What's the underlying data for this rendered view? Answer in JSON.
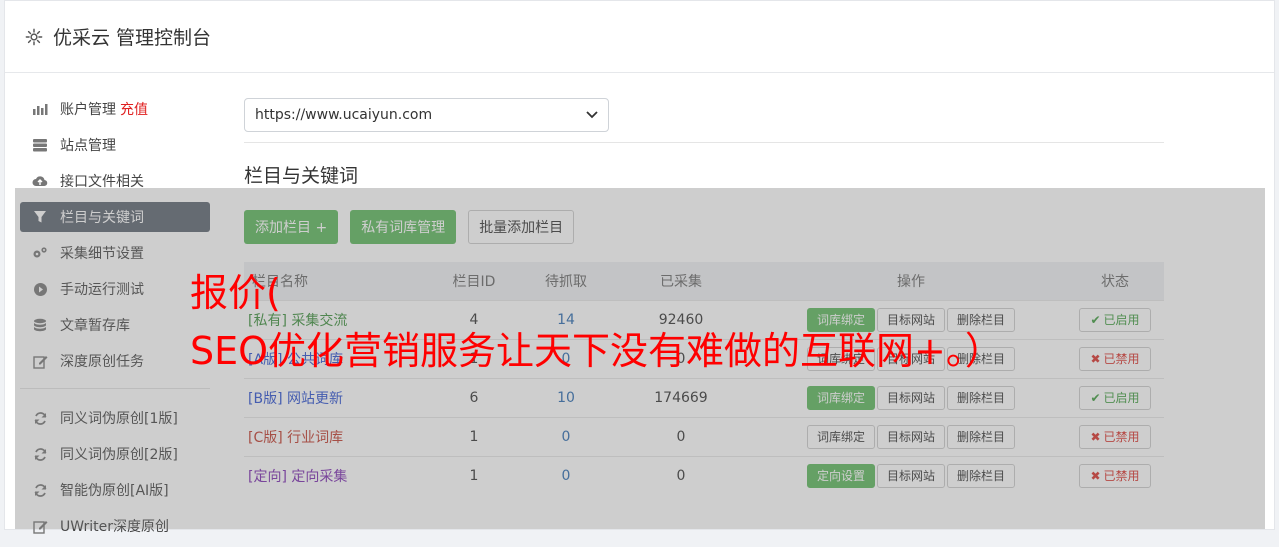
{
  "header": {
    "title": "优采云 管理控制台"
  },
  "sidebar": {
    "items": [
      {
        "label": "账户管理",
        "extra": "充值",
        "icon": "bar-chart-icon"
      },
      {
        "label": "站点管理",
        "icon": "server-icon"
      },
      {
        "label": "接口文件相关",
        "icon": "cloud-upload-icon"
      },
      {
        "label": "栏目与关键词",
        "icon": "filter-icon",
        "active": true
      },
      {
        "label": "采集细节设置",
        "icon": "cogs-icon"
      },
      {
        "label": "手动运行测试",
        "icon": "play-circle-icon"
      },
      {
        "label": "文章暂存库",
        "icon": "database-icon"
      },
      {
        "label": "深度原创任务",
        "icon": "edit-icon"
      }
    ],
    "items2": [
      {
        "label": "同义词伪原创[1版]",
        "icon": "refresh-icon"
      },
      {
        "label": "同义词伪原创[2版]",
        "icon": "refresh-icon"
      },
      {
        "label": "智能伪原创[AI版]",
        "icon": "refresh-icon"
      },
      {
        "label": "UWriter深度原创",
        "icon": "edit-icon"
      }
    ]
  },
  "main": {
    "site_select": "https://www.ucaiyun.com",
    "section_title": "栏目与关键词",
    "buttons": {
      "add": "添加栏目 +",
      "private_lib": "私有词库管理",
      "batch_add": "批量添加栏目"
    },
    "table": {
      "headers": [
        "栏目名称",
        "栏目ID",
        "待抓取",
        "已采集",
        "操作",
        "状态"
      ],
      "rows": [
        {
          "tag": "[私有]",
          "name": "采集交流",
          "id": "4",
          "pending": "14",
          "collected": "92460",
          "op1": "词库绑定",
          "op1_green": true,
          "op2": "目标网站",
          "op3": "删除栏目",
          "status": "已启用",
          "on": true,
          "color": "green"
        },
        {
          "tag": "[A版]",
          "name": "公共词库",
          "id": "1",
          "pending": "0",
          "collected": "0",
          "op1": "词库绑定",
          "op1_green": false,
          "op2": "目标网站",
          "op3": "删除栏目",
          "status": "已禁用",
          "on": false,
          "color": "blue"
        },
        {
          "tag": "[B版]",
          "name": "网站更新",
          "id": "6",
          "pending": "10",
          "collected": "174669",
          "op1": "词库绑定",
          "op1_green": true,
          "op2": "目标网站",
          "op3": "删除栏目",
          "status": "已启用",
          "on": true,
          "color": "blue"
        },
        {
          "tag": "[C版]",
          "name": "行业词库",
          "id": "1",
          "pending": "0",
          "collected": "0",
          "op1": "词库绑定",
          "op1_green": false,
          "op2": "目标网站",
          "op3": "删除栏目",
          "status": "已禁用",
          "on": false,
          "color": "red"
        },
        {
          "tag": "[定向]",
          "name": "定向采集",
          "id": "1",
          "pending": "0",
          "collected": "0",
          "op1": "定向设置",
          "op1_green": true,
          "op2": "目标网站",
          "op3": "删除栏目",
          "status": "已禁用",
          "on": false,
          "color": "purple"
        }
      ]
    }
  },
  "overlay_text": {
    "line1": "报价(",
    "line2": "SEO优化营销服务让天下没有难做的互联网+。）"
  }
}
